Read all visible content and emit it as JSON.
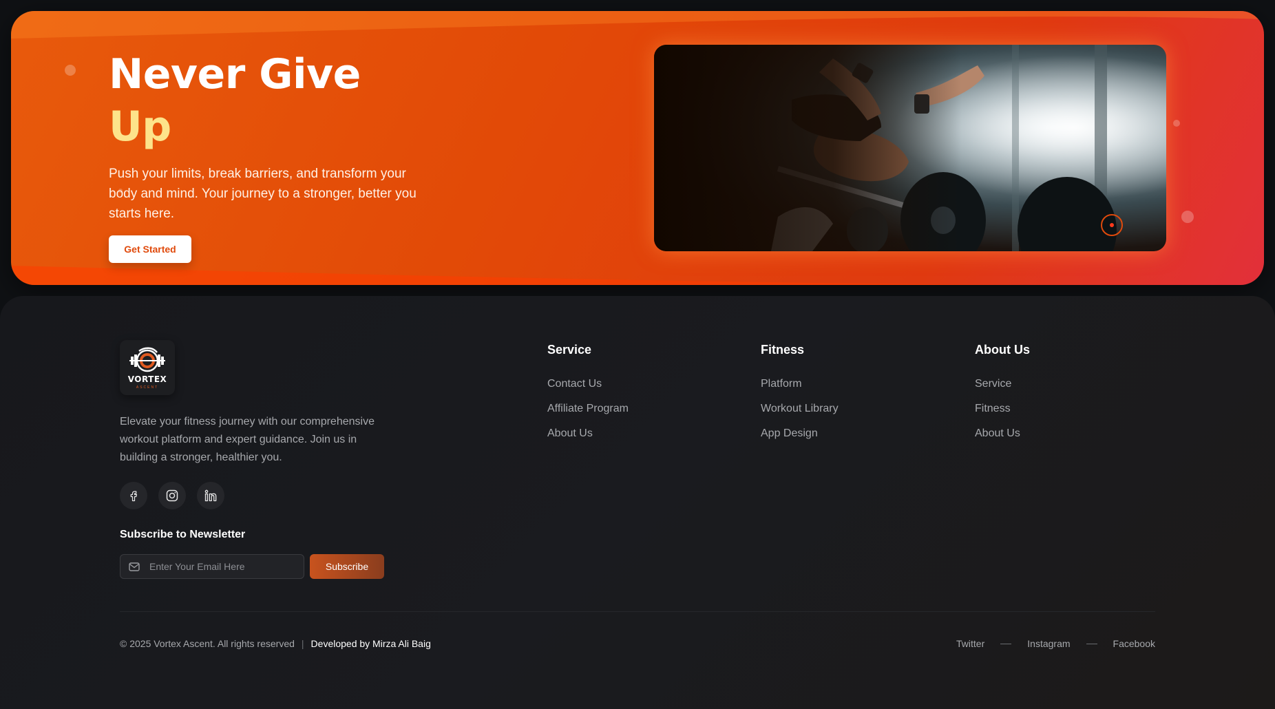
{
  "hero": {
    "title_line1": "Never Give",
    "title_line2": "Up",
    "subtitle": "Push your limits, break barriers, and transform your body and mind. Your journey to a stronger, better you starts here.",
    "cta_label": "Get Started",
    "image_alt": "athlete-lifting-barbell-photo"
  },
  "footer": {
    "brand": {
      "name": "VORTEX",
      "tagline": "ASCENT",
      "description": "Elevate your fitness journey with our comprehensive workout platform and expert guidance. Join us in building a stronger, healthier you."
    },
    "socials": [
      {
        "icon": "facebook-icon"
      },
      {
        "icon": "instagram-icon"
      },
      {
        "icon": "linkedin-icon"
      }
    ],
    "newsletter": {
      "title": "Subscribe to Newsletter",
      "placeholder": "Enter Your Email Here",
      "button_label": "Subscribe"
    },
    "columns": [
      {
        "title": "Service",
        "links": [
          "Contact Us",
          "Affiliate Program",
          "About Us"
        ]
      },
      {
        "title": "Fitness",
        "links": [
          "Platform",
          "Workout Library",
          "App Design"
        ]
      },
      {
        "title": "About Us",
        "links": [
          "Service",
          "Fitness",
          "About Us"
        ]
      }
    ],
    "copyright": "© 2025 Vortex Ascent. All rights reserved",
    "separator": "|",
    "developer": "Developed by Mirza Ali Baig",
    "bottom_links": [
      "Twitter",
      "Instagram",
      "Facebook"
    ]
  },
  "colors": {
    "accent": "#e04a0c",
    "title_highlight": "#fde38a",
    "footer_bg": "#17181c"
  }
}
